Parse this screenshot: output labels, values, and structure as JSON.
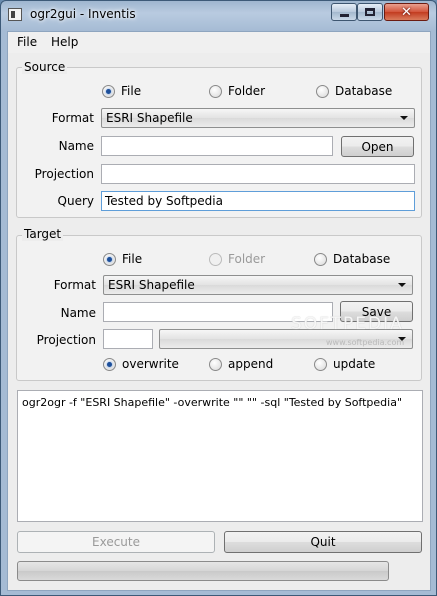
{
  "window": {
    "title": "ogr2gui - Inventis",
    "close_symbol": "✕"
  },
  "menu": [
    "File",
    "Help"
  ],
  "source": {
    "title": "Source",
    "radios": [
      {
        "label": "File",
        "checked": true
      },
      {
        "label": "Folder",
        "checked": false
      },
      {
        "label": "Database",
        "checked": false
      }
    ],
    "format_label": "Format",
    "format_value": "ESRI Shapefile",
    "name_label": "Name",
    "name_value": "",
    "open_button": "Open",
    "projection_label": "Projection",
    "projection_value": "",
    "query_label": "Query",
    "query_value": "Tested by Softpedia"
  },
  "target": {
    "title": "Target",
    "radios": [
      {
        "label": "File",
        "checked": true
      },
      {
        "label": "Folder",
        "checked": false,
        "disabled": true
      },
      {
        "label": "Database",
        "checked": false
      }
    ],
    "format_label": "Format",
    "format_value": "ESRI Shapefile",
    "name_label": "Name",
    "name_value": "",
    "save_button": "Save",
    "projection_label": "Projection",
    "projection_value": "",
    "projection_select": "",
    "modes": [
      {
        "label": "overwrite",
        "checked": true
      },
      {
        "label": "append",
        "checked": false
      },
      {
        "label": "update",
        "checked": false
      }
    ]
  },
  "command_text": "ogr2ogr -f \"ESRI Shapefile\" -overwrite \"\" \"\" -sql \"Tested by Softpedia\"",
  "buttons": {
    "execute": "Execute",
    "quit": "Quit"
  },
  "progress": {
    "value": 0
  },
  "watermark": {
    "main": "SOFTPEDIA",
    "sub": "www.softpedia.com"
  }
}
